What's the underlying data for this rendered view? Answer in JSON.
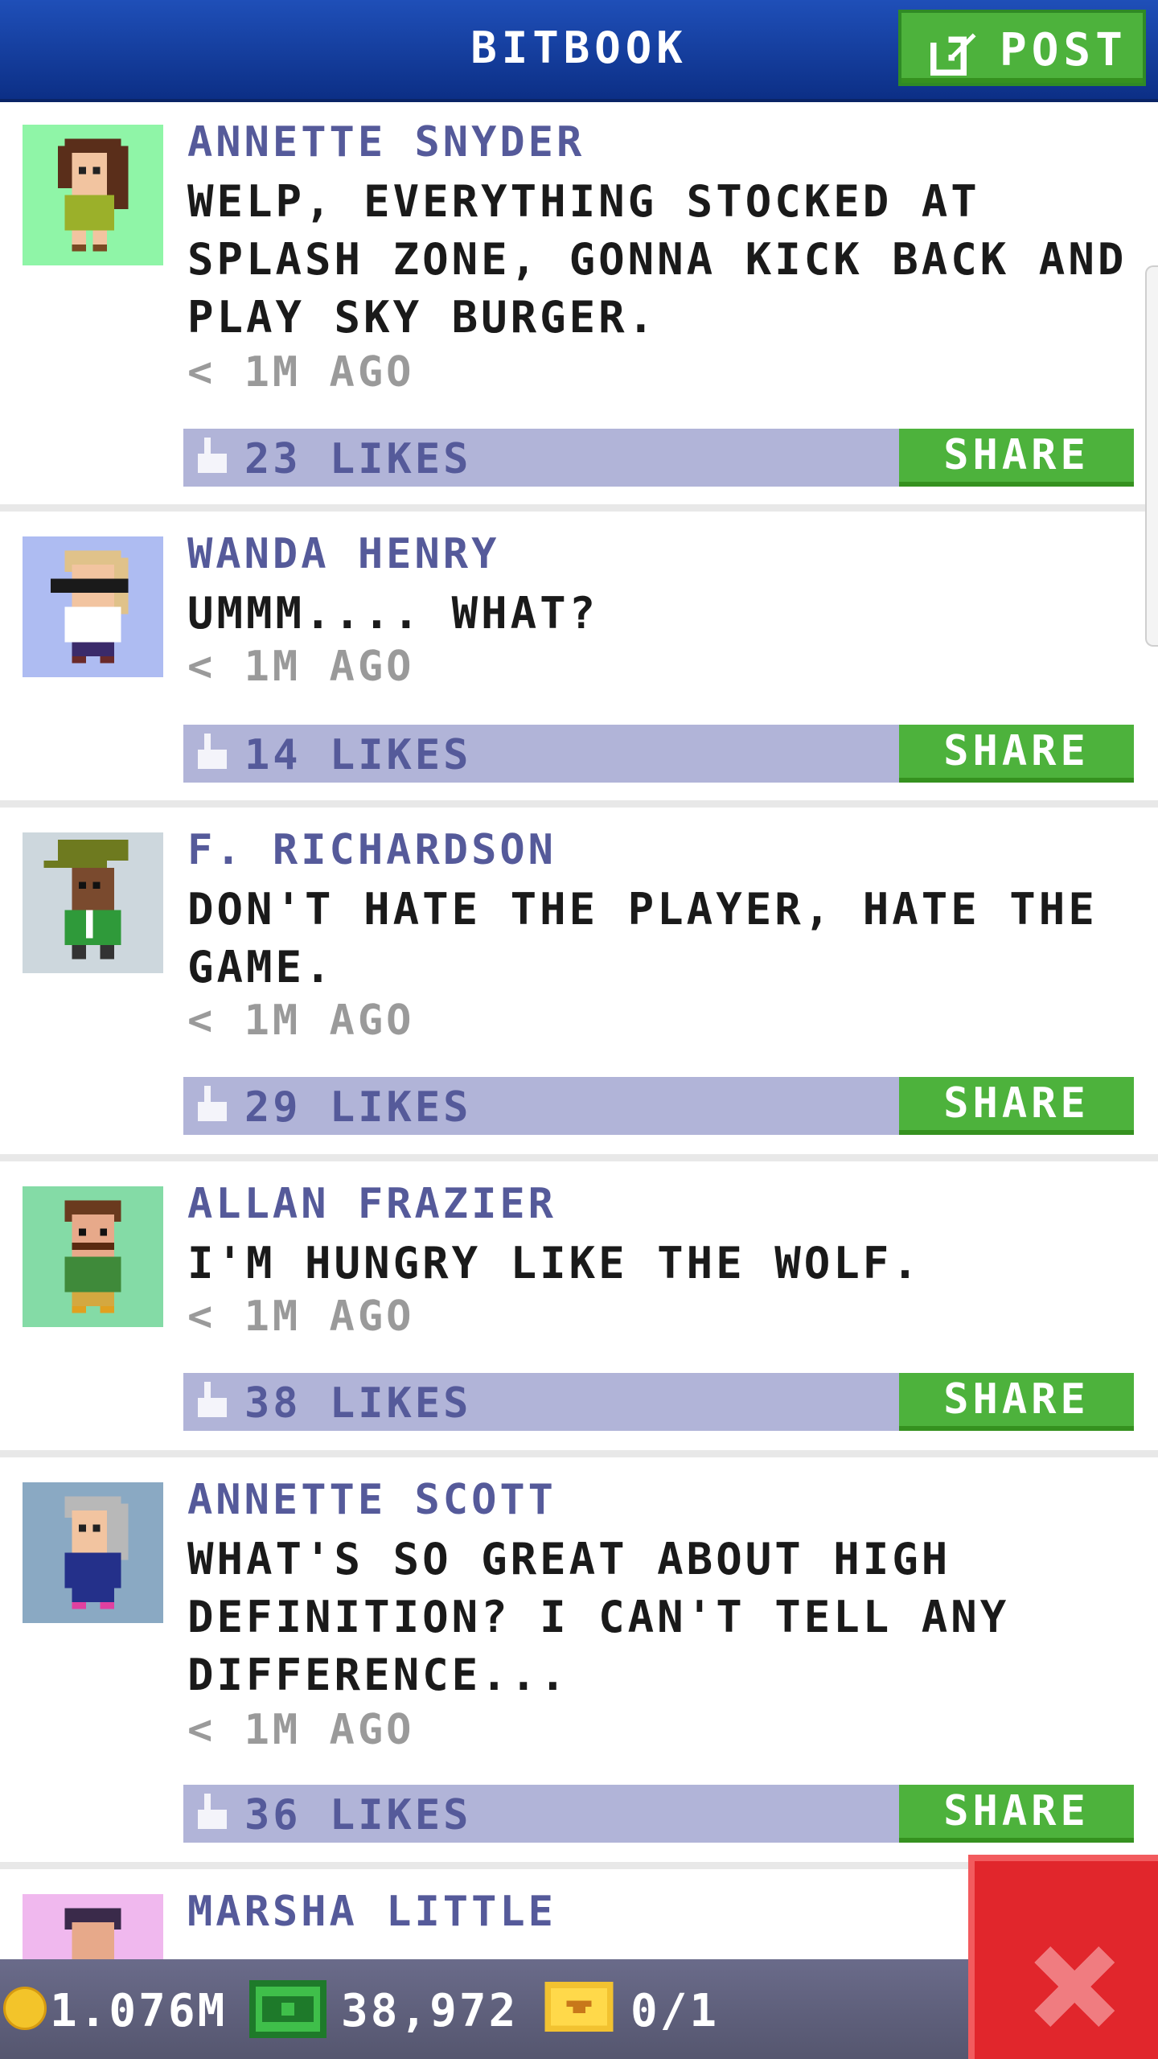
{
  "header": {
    "title": "BITBOOK",
    "post_label": "POST",
    "post_icon": "compose-icon"
  },
  "posts": [
    {
      "author": "ANNETTE SNYDER",
      "message": "WELP, EVERYTHING STOCKED AT SPLASH ZONE, GONNA KICK BACK AND PLAY SKY BURGER.",
      "time": "< 1M AGO",
      "likes": "23 LIKES",
      "share_label": "SHARE",
      "avatar_bg": "#8ff5a7"
    },
    {
      "author": "WANDA HENRY",
      "message": "UMMM....  WHAT?",
      "time": "< 1M AGO",
      "likes": "14 LIKES",
      "share_label": "SHARE",
      "avatar_bg": "#aebcf2"
    },
    {
      "author": "F. RICHARDSON",
      "message": "DON'T HATE THE PLAYER, HATE THE GAME.",
      "time": "< 1M AGO",
      "likes": "29 LIKES",
      "share_label": "SHARE",
      "avatar_bg": "#cdd7dd"
    },
    {
      "author": "ALLAN FRAZIER",
      "message": "I'M HUNGRY LIKE THE WOLF.",
      "time": "< 1M AGO",
      "likes": "38 LIKES",
      "share_label": "SHARE",
      "avatar_bg": "#84dba6"
    },
    {
      "author": "ANNETTE SCOTT",
      "message": "WHAT'S SO GREAT ABOUT HIGH DEFINITION? I CAN'T TELL ANY DIFFERENCE...",
      "time": "< 1M AGO",
      "likes": "36 LIKES",
      "share_label": "SHARE",
      "avatar_bg": "#8aa9c3"
    },
    {
      "author": "MARSHA LITTLE",
      "avatar_bg": "#f0b8ee"
    }
  ],
  "status": {
    "coins": "1.076M",
    "bux": "38,972",
    "vip": "0/1",
    "coin_icon": "coin-icon",
    "bux_icon": "bux-icon",
    "vip_icon": "vip-ticket-icon"
  },
  "close_icon": "close-icon",
  "colors": {
    "header_blue": "#1f4fb8",
    "green": "#4db23c",
    "like_bar": "#b1b4d8",
    "author": "#555a9a",
    "close_red": "#e1262c"
  }
}
